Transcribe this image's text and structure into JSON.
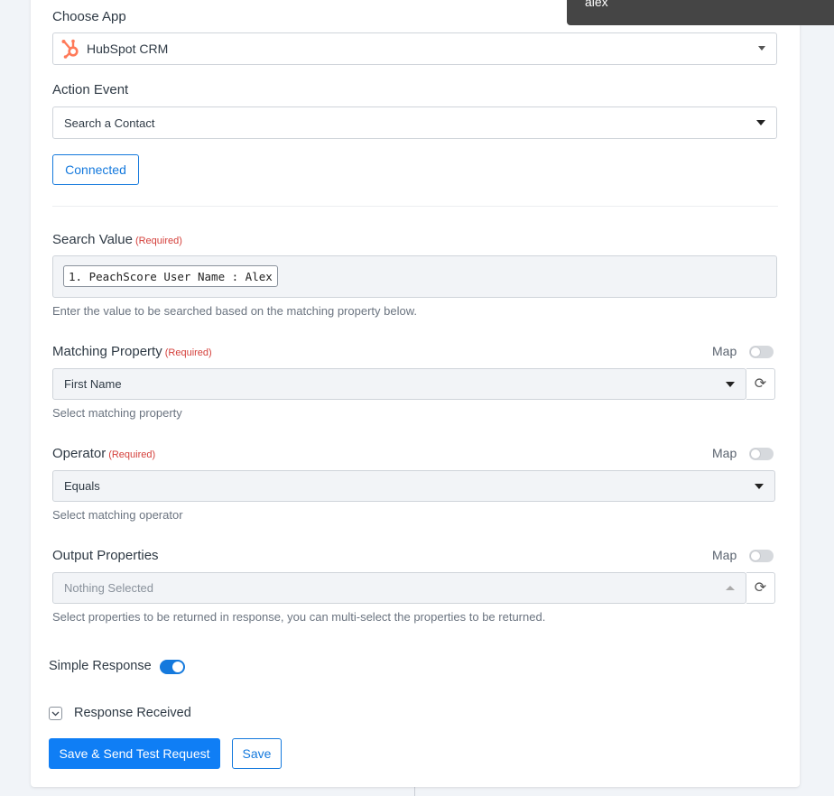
{
  "choose_app": {
    "label": "Choose App",
    "selected": "HubSpot CRM",
    "icon": "hubspot-logo-icon",
    "icon_color": "#ff7a59"
  },
  "action_event": {
    "label": "Action Event",
    "selected": "Search a Contact"
  },
  "connected_button": "Connected",
  "search_value": {
    "label": "Search Value",
    "required": "(Required)",
    "tag": "1. PeachScore User Name : Alex",
    "help": "Enter the value to be searched based on the matching property below."
  },
  "matching_property": {
    "label": "Matching Property",
    "required": "(Required)",
    "map_label": "Map",
    "selected": "First Name",
    "help": "Select matching property"
  },
  "operator": {
    "label": "Operator",
    "required": "(Required)",
    "map_label": "Map",
    "selected": "Equals",
    "help": "Select matching operator"
  },
  "output_properties": {
    "label": "Output Properties",
    "map_label": "Map",
    "placeholder": "Nothing Selected",
    "help": "Select properties to be returned in response, you can multi-select the properties to be returned."
  },
  "simple_response": {
    "label": "Simple Response",
    "enabled": true
  },
  "response_received": {
    "label": "Response Received"
  },
  "buttons": {
    "save_send": "Save & Send Test Request",
    "save": "Save"
  },
  "tooltip_text": "alex",
  "colors": {
    "primary": "#0f7ef5",
    "required": "#d43f3a"
  }
}
